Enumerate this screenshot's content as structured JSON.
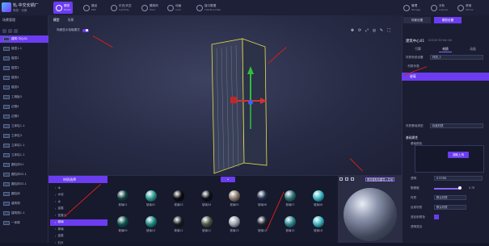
{
  "app": {
    "title": "轧·中交长锅厂",
    "subtitle": "简易 · 切换"
  },
  "toolbar": [
    {
      "label": "模型",
      "sub": "Model",
      "active": true
    },
    {
      "label": "路径",
      "sub": "Path",
      "active": false
    },
    {
      "label": "灯光/天空",
      "sub": "Light/Sky",
      "active": false
    },
    {
      "label": "模拟风",
      "sub": "Wind",
      "active": false
    },
    {
      "label": "动画",
      "sub": "Anim",
      "active": false
    },
    {
      "label": "接口数据",
      "sub": "Interface Data",
      "active": false
    },
    {
      "label": "管理",
      "sub": "Manage",
      "active": false
    },
    {
      "label": "分析",
      "sub": "Analyze",
      "active": false
    },
    {
      "label": "其他",
      "sub": "Others",
      "active": false
    }
  ],
  "left": {
    "tab": "场景管理",
    "tree": [
      {
        "label": "建筑·中心01",
        "selected": true
      },
      {
        "label": "楼层1-1"
      },
      {
        "label": "楼层2"
      },
      {
        "label": "楼层3"
      },
      {
        "label": "楼层4"
      },
      {
        "label": "楼层5"
      },
      {
        "label": "工程板3"
      },
      {
        "label": "边框4"
      },
      {
        "label": "边框3"
      },
      {
        "label": "立体柱1-1"
      },
      {
        "label": "立体柱3"
      },
      {
        "label": "立体柱1-1"
      },
      {
        "label": "立体柱1-1"
      },
      {
        "label": "圆柱体01"
      },
      {
        "label": "圆柱体02-1"
      },
      {
        "label": "圆柱体02-1"
      },
      {
        "label": "圆柱体"
      },
      {
        "label": "建筑物"
      },
      {
        "label": "建筑物1-1"
      },
      {
        "label": "一体楼"
      }
    ]
  },
  "viewport": {
    "tabs": [
      "模型",
      "场景"
    ],
    "pick_label": "场景显示拾取模式"
  },
  "right": {
    "tabs": [
      "场景设置",
      "模型设置"
    ],
    "object_name": "建筑中心01",
    "object_code": "UCS10·30·Xm·XX",
    "prop_tabs": [
      "引擎",
      "材质",
      "动画"
    ],
    "fields": [
      {
        "label": "材质系统设置",
        "value": "材质_2"
      },
      {
        "label": "材质基础类型",
        "value": "标准材质"
      }
    ],
    "selected_item": "玻璃",
    "section_base": "基础属性",
    "base_label": "基础颜色",
    "pick_button": "选取上传",
    "params": [
      {
        "label": "透明",
        "value": "0.5788"
      },
      {
        "label": "粗糙度",
        "value": "0.78"
      },
      {
        "label": "材质",
        "value": "默认材质"
      },
      {
        "label": "反射材质",
        "value": "默认材质"
      },
      {
        "label": "漫反射颜色",
        "value": ""
      },
      {
        "label": "透明混合",
        "value": ""
      }
    ]
  },
  "bottom": {
    "header": "材质选择",
    "categories": [
      {
        "label": "木",
        "selected": false
      },
      {
        "label": "水泥",
        "selected": false
      },
      {
        "label": "水",
        "selected": false
      },
      {
        "label": "金属",
        "selected": false
      },
      {
        "label": "混凝土",
        "selected": false
      },
      {
        "label": "玻璃",
        "selected": true
      },
      {
        "label": "玻璃",
        "selected": false
      },
      {
        "label": "金属",
        "selected": false
      },
      {
        "label": "石头",
        "selected": false
      }
    ],
    "materials_row1": [
      {
        "label": "玻璃01",
        "color": "#12403f"
      },
      {
        "label": "玻璃02",
        "color": "#2d9c94"
      },
      {
        "label": "玻璃03",
        "color": "#0c0c10"
      },
      {
        "label": "玻璃04",
        "color": "#0c0f18"
      },
      {
        "label": "玻璃05",
        "color": "#8a7a6a"
      },
      {
        "label": "玻璃06",
        "color": "#1d2c4a"
      },
      {
        "label": "玻璃07",
        "color": "#2e7478"
      },
      {
        "label": "玻璃08",
        "color": "#3bb9c8"
      }
    ],
    "materials_row2": [
      {
        "label": "玻璃09",
        "color": "#0f5550"
      },
      {
        "label": "玻璃10",
        "color": "#1f8b84"
      },
      {
        "label": "玻璃11",
        "color": "#141d22"
      },
      {
        "label": "玻璃12",
        "color": "#4a5a48"
      },
      {
        "label": "玻璃13",
        "color": "#9ea4b0"
      },
      {
        "label": "玻璃14",
        "color": "#1b2330"
      },
      {
        "label": "玻璃15",
        "color": "#2f8a92"
      },
      {
        "label": "玻璃16",
        "color": "#3db5c2"
      }
    ],
    "preview_tip": "预览模型效果导入并测"
  }
}
